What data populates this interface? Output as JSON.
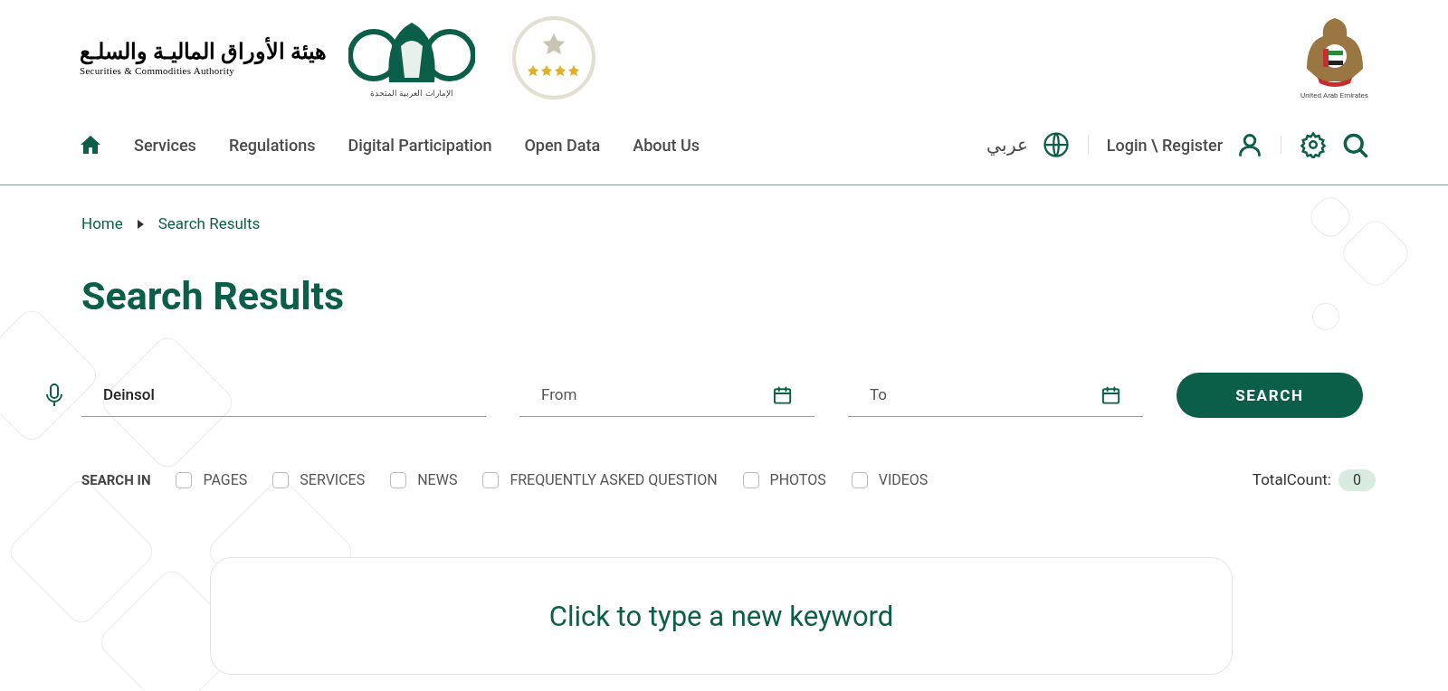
{
  "header": {
    "logo": {
      "arabic_name": "هيئة الأوراق الماليـة والسلـع",
      "english_name": "Securities & Commodities Authority",
      "emblem_caption": "الإمارات العربية المتحدة"
    },
    "uae_emblem_caption": "United Arab Emirates"
  },
  "nav": {
    "items": [
      {
        "label": "Services"
      },
      {
        "label": "Regulations"
      },
      {
        "label": "Digital Participation"
      },
      {
        "label": "Open Data"
      },
      {
        "label": "About Us"
      }
    ],
    "language": "عربي",
    "login": "Login \\ Register"
  },
  "breadcrumb": [
    {
      "label": "Home"
    },
    {
      "label": "Search Results"
    }
  ],
  "title": "Search Results",
  "search": {
    "keyword": "Deinsol",
    "from_placeholder": "From",
    "to_placeholder": "To",
    "button": "SEARCH"
  },
  "search_in": {
    "label": "SEARCH IN",
    "options": [
      {
        "label": "PAGES",
        "checked": false
      },
      {
        "label": "SERVICES",
        "checked": false
      },
      {
        "label": "NEWS",
        "checked": false
      },
      {
        "label": "FREQUENTLY ASKED QUESTION",
        "checked": false
      },
      {
        "label": "PHOTOS",
        "checked": false
      },
      {
        "label": "VIDEOS",
        "checked": false
      }
    ]
  },
  "total_count": {
    "label": "TotalCount:",
    "value": "0"
  },
  "prompt": "Click to type a new keyword"
}
